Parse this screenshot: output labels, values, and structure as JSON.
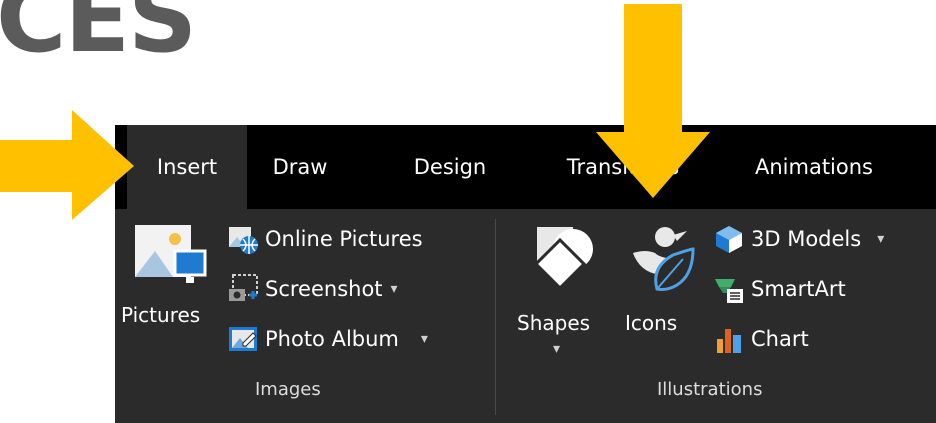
{
  "decor": {
    "title_fragment": "CES"
  },
  "tabs": [
    {
      "label": "Insert",
      "active": true
    },
    {
      "label": "Draw",
      "active": false
    },
    {
      "label": "Design",
      "active": false
    },
    {
      "label": "Transitions",
      "active": false
    },
    {
      "label": "Animations",
      "active": false
    }
  ],
  "images_group": {
    "label": "Images",
    "pictures_label": "Pictures",
    "online_pictures_label": "Online Pictures",
    "screenshot_label": "Screenshot",
    "photo_album_label": "Photo Album"
  },
  "illustrations_group": {
    "label": "Illustrations",
    "shapes_label": "Shapes",
    "icons_label": "Icons",
    "models_3d_label": "3D Models",
    "smartart_label": "SmartArt",
    "chart_label": "Chart"
  },
  "colors": {
    "tabbar": "#000000",
    "panel": "#2b2b2b",
    "arrow": "#ffc000",
    "accent_blue": "#4ea1e6",
    "text": "#ffffff"
  },
  "icons": [
    "pictures-icon",
    "online-pictures-icon",
    "screenshot-icon",
    "photo-album-icon",
    "shapes-icon",
    "icons-icon",
    "3d-models-icon",
    "smartart-icon",
    "chart-icon"
  ]
}
